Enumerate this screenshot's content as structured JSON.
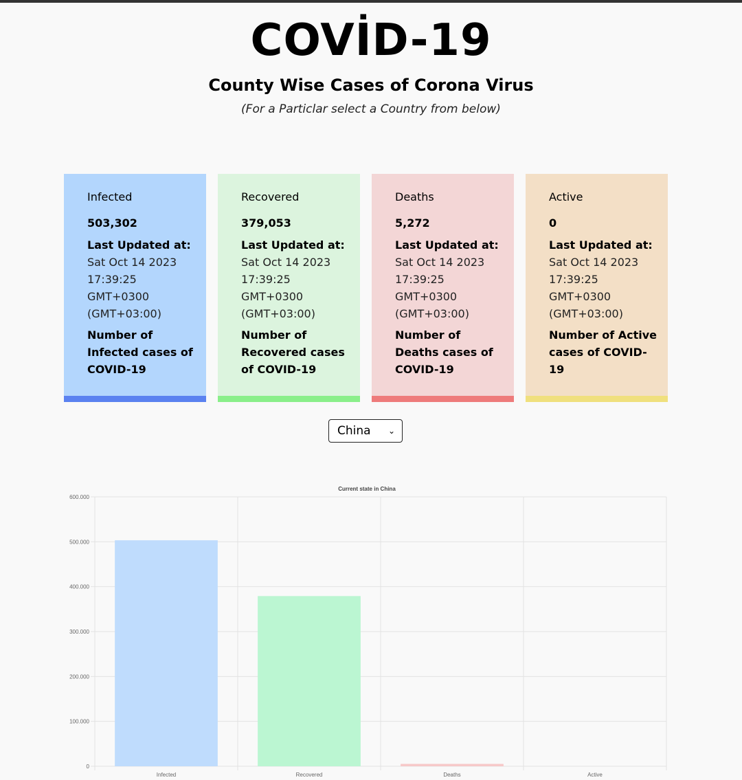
{
  "page": {
    "title": "COVİD-19",
    "subtitle": "County Wise Cases of Corona Virus",
    "hint": "(For a Particlar select a Country from below)"
  },
  "cards": [
    {
      "label": "Infected",
      "count": "503,302",
      "updated_label": "Last Updated at:",
      "updated_value": "Sat Oct 14 2023 17:39:25 GMT+0300 (GMT+03:00)",
      "description": "Number of Infected cases of COVID-19",
      "bg_color": "#b3d6fd",
      "accent_color": "#5b82f0"
    },
    {
      "label": "Recovered",
      "count": "379,053",
      "updated_label": "Last Updated at:",
      "updated_value": "Sat Oct 14 2023 17:39:25 GMT+0300 (GMT+03:00)",
      "description": "Number of Recovered cases of COVID-19",
      "bg_color": "#dcf4de",
      "accent_color": "#8aef8a"
    },
    {
      "label": "Deaths",
      "count": "5,272",
      "updated_label": "Last Updated at:",
      "updated_value": "Sat Oct 14 2023 17:39:25 GMT+0300 (GMT+03:00)",
      "description": "Number of Deaths cases of COVID-19",
      "bg_color": "#f3d6d6",
      "accent_color": "#ee7b7b"
    },
    {
      "label": "Active",
      "count": "0",
      "updated_label": "Last Updated at:",
      "updated_value": "Sat Oct 14 2023 17:39:25 GMT+0300 (GMT+03:00)",
      "description": "Number of Active cases of COVID-19",
      "bg_color": "#f3dfc6",
      "accent_color": "#f0e07e"
    }
  ],
  "country_select": {
    "value": "China",
    "icon": "chevron-down-icon"
  },
  "chart_data": {
    "type": "bar",
    "title": "Current state in China",
    "categories": [
      "Infected",
      "Recovered",
      "Deaths",
      "Active"
    ],
    "values": [
      503302,
      379053,
      5272,
      0
    ],
    "colors": [
      "#bfdcfd",
      "#bbf6d2",
      "#f7c9c9",
      "#f6e6b5"
    ],
    "ylim": [
      0,
      600000
    ],
    "yticks": [
      0,
      100000,
      200000,
      300000,
      400000,
      500000,
      600000
    ],
    "ytick_labels": [
      "0",
      "100.000",
      "200.000",
      "300.000",
      "400.000",
      "500.000",
      "600.000"
    ],
    "grid": true,
    "legend": "none"
  }
}
